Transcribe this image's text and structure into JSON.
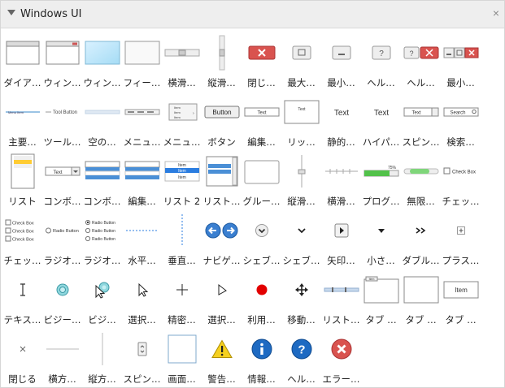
{
  "panel": {
    "title": "Windows UI",
    "close_glyph": "×"
  },
  "rows": [
    [
      {
        "label": "ダイア…",
        "icon": "dialog-window-icon"
      },
      {
        "label": "ウィン…",
        "icon": "window-icon"
      },
      {
        "label": "ウィン…",
        "icon": "window-blue-icon"
      },
      {
        "label": "フィー…",
        "icon": "form-icon"
      },
      {
        "label": "横滑…",
        "icon": "horizontal-slider-icon"
      },
      {
        "label": "縦滑…",
        "icon": "vertical-slider-icon"
      },
      {
        "label": "閉じ…",
        "icon": "close-button-icon"
      },
      {
        "label": "最大…",
        "icon": "maximize-button-icon"
      },
      {
        "label": "最小…",
        "icon": "minimize-button-icon"
      },
      {
        "label": "ヘル…",
        "icon": "help-button-icon"
      },
      {
        "label": "ヘル…",
        "icon": "help-close-button-icon"
      },
      {
        "label": "最小…",
        "icon": "min-max-close-icon"
      }
    ],
    [
      {
        "label": "主要…",
        "icon": "main-menu-icon"
      },
      {
        "label": "ツール…",
        "icon": "toolbar-icon"
      },
      {
        "label": "空の…",
        "icon": "empty-menu-icon"
      },
      {
        "label": "メニュ…",
        "icon": "menu-bar-icon"
      },
      {
        "label": "メニュ…",
        "icon": "menu-list-icon"
      },
      {
        "label": "ボタン",
        "icon": "button-icon"
      },
      {
        "label": "編集…",
        "icon": "text-box-icon"
      },
      {
        "label": "リッ…",
        "icon": "rich-text-icon"
      },
      {
        "label": "静的…",
        "icon": "static-text-icon"
      },
      {
        "label": "ハイパ…",
        "icon": "hyperlink-icon"
      },
      {
        "label": "スピン…",
        "icon": "spin-box-icon"
      },
      {
        "label": "検索…",
        "icon": "search-box-icon"
      }
    ],
    [
      {
        "label": "リスト",
        "icon": "list-icon"
      },
      {
        "label": "コンボ…",
        "icon": "combo-box-icon"
      },
      {
        "label": "コンボ…",
        "icon": "combo-box-open-icon"
      },
      {
        "label": "編集…",
        "icon": "edit-list-icon"
      },
      {
        "label": "リスト 2",
        "icon": "list-2-icon"
      },
      {
        "label": "リスト…",
        "icon": "list-box-icon"
      },
      {
        "label": "グルー…",
        "icon": "group-box-icon"
      },
      {
        "label": "縦滑…",
        "icon": "vertical-track-icon"
      },
      {
        "label": "横滑…",
        "icon": "horizontal-track-icon"
      },
      {
        "label": "プログ…",
        "icon": "progress-bar-icon"
      },
      {
        "label": "無限…",
        "icon": "indeterminate-progress-icon"
      },
      {
        "label": "チェッ…",
        "icon": "check-box-icon"
      }
    ],
    [
      {
        "label": "チェッ…",
        "icon": "check-box-group-icon"
      },
      {
        "label": "ラジオ…",
        "icon": "radio-button-icon"
      },
      {
        "label": "ラジオ…",
        "icon": "radio-group-icon"
      },
      {
        "label": "水平…",
        "icon": "horizontal-line-icon"
      },
      {
        "label": "垂直…",
        "icon": "vertical-line-icon"
      },
      {
        "label": "ナビゲ…",
        "icon": "navigation-arrows-icon"
      },
      {
        "label": "シェブ…",
        "icon": "chevron-circle-icon"
      },
      {
        "label": "シェブ…",
        "icon": "chevron-down-icon"
      },
      {
        "label": "矢印…",
        "icon": "arrow-button-icon"
      },
      {
        "label": "小さ…",
        "icon": "small-triangle-icon"
      },
      {
        "label": "ダブル…",
        "icon": "double-chevron-icon"
      },
      {
        "label": "プラス…",
        "icon": "plus-box-icon"
      }
    ],
    [
      {
        "label": "テキス…",
        "icon": "text-cursor-icon"
      },
      {
        "label": "ビジー…",
        "icon": "busy-cursor-icon"
      },
      {
        "label": "ビジ…",
        "icon": "busy-pointer-icon"
      },
      {
        "label": "選択…",
        "icon": "select-arrow-icon"
      },
      {
        "label": "精密…",
        "icon": "precision-cross-icon"
      },
      {
        "label": "選択…",
        "icon": "select-arrow-outline-icon"
      },
      {
        "label": "利用…",
        "icon": "unavailable-dot-icon"
      },
      {
        "label": "移動…",
        "icon": "move-cursor-icon"
      },
      {
        "label": "リスト…",
        "icon": "list-view-icon"
      },
      {
        "label": "タブ …",
        "icon": "tab-panel-icon"
      },
      {
        "label": "タブ …",
        "icon": "tab-empty-icon"
      },
      {
        "label": "タブ …",
        "icon": "tab-item-icon"
      }
    ],
    [
      {
        "label": "閉じる",
        "icon": "close-x-icon"
      },
      {
        "label": "横方…",
        "icon": "horizontal-divider-icon"
      },
      {
        "label": "縦方…",
        "icon": "vertical-divider-icon"
      },
      {
        "label": "スピン…",
        "icon": "spin-button-icon"
      },
      {
        "label": "画面…",
        "icon": "screen-icon"
      },
      {
        "label": "警告…",
        "icon": "warning-icon"
      },
      {
        "label": "情報…",
        "icon": "info-icon"
      },
      {
        "label": "ヘル…",
        "icon": "help-icon"
      },
      {
        "label": "エラー…",
        "icon": "error-icon"
      }
    ]
  ],
  "thumb_text": {
    "tool_button": "Tool Button",
    "button": "Button",
    "text": "Text",
    "search": "Search",
    "item": "Item",
    "check_box": "Check Box",
    "radio_button": "Radio Button",
    "progress_pct": "75%",
    "tab_item": "Item"
  }
}
